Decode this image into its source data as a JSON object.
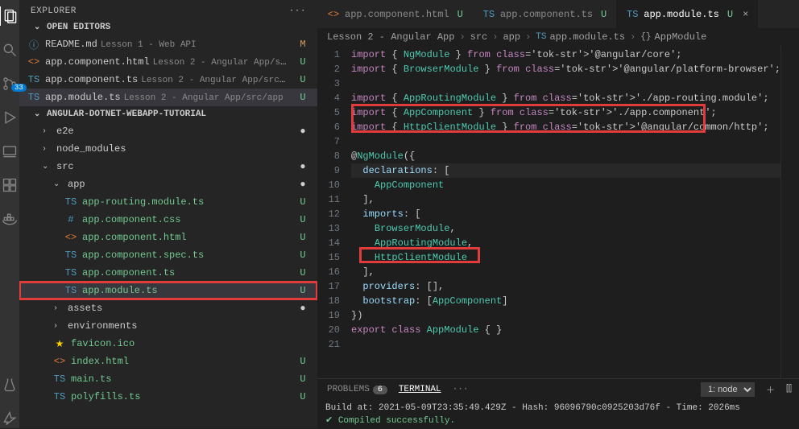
{
  "explorer": {
    "title": "EXPLORER",
    "openEditorsLabel": "OPEN EDITORS",
    "openEditors": [
      {
        "icon": "ⓘ",
        "iconClass": "file-info",
        "name": "README.md",
        "desc": "Lesson 1 - Web API",
        "status": "M",
        "statusClass": "status-m"
      },
      {
        "icon": "<>",
        "iconClass": "file-html",
        "name": "app.component.html",
        "desc": "Lesson 2 - Angular App/s...",
        "status": "U",
        "statusClass": "status-u"
      },
      {
        "icon": "TS",
        "iconClass": "file-ts",
        "name": "app.component.ts",
        "desc": "Lesson 2 - Angular App/src/...",
        "status": "U",
        "statusClass": "status-u"
      },
      {
        "icon": "TS",
        "iconClass": "file-ts",
        "name": "app.module.ts",
        "desc": "Lesson 2 - Angular App/src/app",
        "status": "U",
        "statusClass": "status-u",
        "selected": true
      }
    ],
    "workspaceLabel": "ANGULAR-DOTNET-WEBAPP-TUTORIAL",
    "tree": [
      {
        "type": "folder",
        "name": "e2e",
        "indent": 1,
        "arrow": "›",
        "status": "●",
        "statusClass": "status-dot"
      },
      {
        "type": "folder",
        "name": "node_modules",
        "indent": 1,
        "arrow": "›"
      },
      {
        "type": "folder",
        "name": "src",
        "indent": 1,
        "arrow": "⌄",
        "status": "●",
        "statusClass": "status-dot"
      },
      {
        "type": "folder",
        "name": "app",
        "indent": 2,
        "arrow": "⌄",
        "status": "●",
        "statusClass": "status-dot"
      },
      {
        "type": "file",
        "icon": "TS",
        "iconClass": "file-ts",
        "name": "app-routing.module.ts",
        "indent": 3,
        "status": "U",
        "statusClass": "status-u",
        "labelColor": "#73c991"
      },
      {
        "type": "file",
        "icon": "#",
        "iconClass": "file-css",
        "name": "app.component.css",
        "indent": 3,
        "status": "U",
        "statusClass": "status-u",
        "labelColor": "#73c991"
      },
      {
        "type": "file",
        "icon": "<>",
        "iconClass": "file-html",
        "name": "app.component.html",
        "indent": 3,
        "status": "U",
        "statusClass": "status-u",
        "labelColor": "#73c991"
      },
      {
        "type": "file",
        "icon": "TS",
        "iconClass": "file-ts",
        "name": "app.component.spec.ts",
        "indent": 3,
        "status": "U",
        "statusClass": "status-u",
        "labelColor": "#73c991"
      },
      {
        "type": "file",
        "icon": "TS",
        "iconClass": "file-ts",
        "name": "app.component.ts",
        "indent": 3,
        "status": "U",
        "statusClass": "status-u",
        "labelColor": "#73c991"
      },
      {
        "type": "file",
        "icon": "TS",
        "iconClass": "file-ts",
        "name": "app.module.ts",
        "indent": 3,
        "status": "U",
        "statusClass": "status-u",
        "labelColor": "#73c991",
        "highlighted": true,
        "selected": true
      },
      {
        "type": "folder",
        "name": "assets",
        "indent": 2,
        "arrow": "›",
        "status": "●",
        "statusClass": "status-dot"
      },
      {
        "type": "folder",
        "name": "environments",
        "indent": 2,
        "arrow": "›"
      },
      {
        "type": "file",
        "icon": "★",
        "iconClass": "file-star",
        "name": "favicon.ico",
        "indent": 2,
        "labelColor": "#73c991"
      },
      {
        "type": "file",
        "icon": "<>",
        "iconClass": "file-html",
        "name": "index.html",
        "indent": 2,
        "status": "U",
        "statusClass": "status-u",
        "labelColor": "#73c991"
      },
      {
        "type": "file",
        "icon": "TS",
        "iconClass": "file-ts",
        "name": "main.ts",
        "indent": 2,
        "status": "U",
        "statusClass": "status-u",
        "labelColor": "#73c991"
      },
      {
        "type": "file",
        "icon": "TS",
        "iconClass": "file-ts",
        "name": "polyfills.ts",
        "indent": 2,
        "status": "U",
        "statusClass": "status-u",
        "labelColor": "#73c991"
      }
    ]
  },
  "scmBadge": "33",
  "tabs": [
    {
      "icon": "<>",
      "iconClass": "file-html",
      "name": "app.component.html",
      "mod": "U"
    },
    {
      "icon": "TS",
      "iconClass": "file-ts",
      "name": "app.component.ts",
      "mod": "U"
    },
    {
      "icon": "TS",
      "iconClass": "file-ts",
      "name": "app.module.ts",
      "mod": "U",
      "active": true,
      "close": true
    }
  ],
  "breadcrumbs": [
    {
      "label": "Lesson 2 - Angular App"
    },
    {
      "label": "src"
    },
    {
      "label": "app"
    },
    {
      "icon": "TS",
      "iconClass": "file-ts",
      "label": "app.module.ts"
    },
    {
      "icon": "{}",
      "label": "AppModule"
    }
  ],
  "editor": {
    "lines": 21,
    "codeRaw": [
      "import { NgModule } from '@angular/core';",
      "import { BrowserModule } from '@angular/platform-browser';",
      "",
      "import { AppRoutingModule } from './app-routing.module';",
      "import { AppComponent } from './app.component';",
      "import { HttpClientModule } from '@angular/common/http';",
      "",
      "@NgModule({",
      "  declarations: [",
      "    AppComponent",
      "  ],",
      "  imports: [",
      "    BrowserModule,",
      "    AppRoutingModule,",
      "    HttpClientModule",
      "  ],",
      "  providers: [],",
      "  bootstrap: [AppComponent]",
      "})",
      "export class AppModule { }",
      ""
    ],
    "highlightedCodeLines": [
      5,
      6,
      15
    ],
    "selectedLine": 9
  },
  "panel": {
    "problemsLabel": "PROBLEMS",
    "problemsCount": "6",
    "terminalLabel": "TERMINAL",
    "selector": "1: node",
    "terminalLine1": "Build at: 2021-05-09T23:35:49.429Z - Hash: 96096790c0925203d76f - Time: 2026ms",
    "terminalLine2": "✔ Compiled successfully."
  }
}
